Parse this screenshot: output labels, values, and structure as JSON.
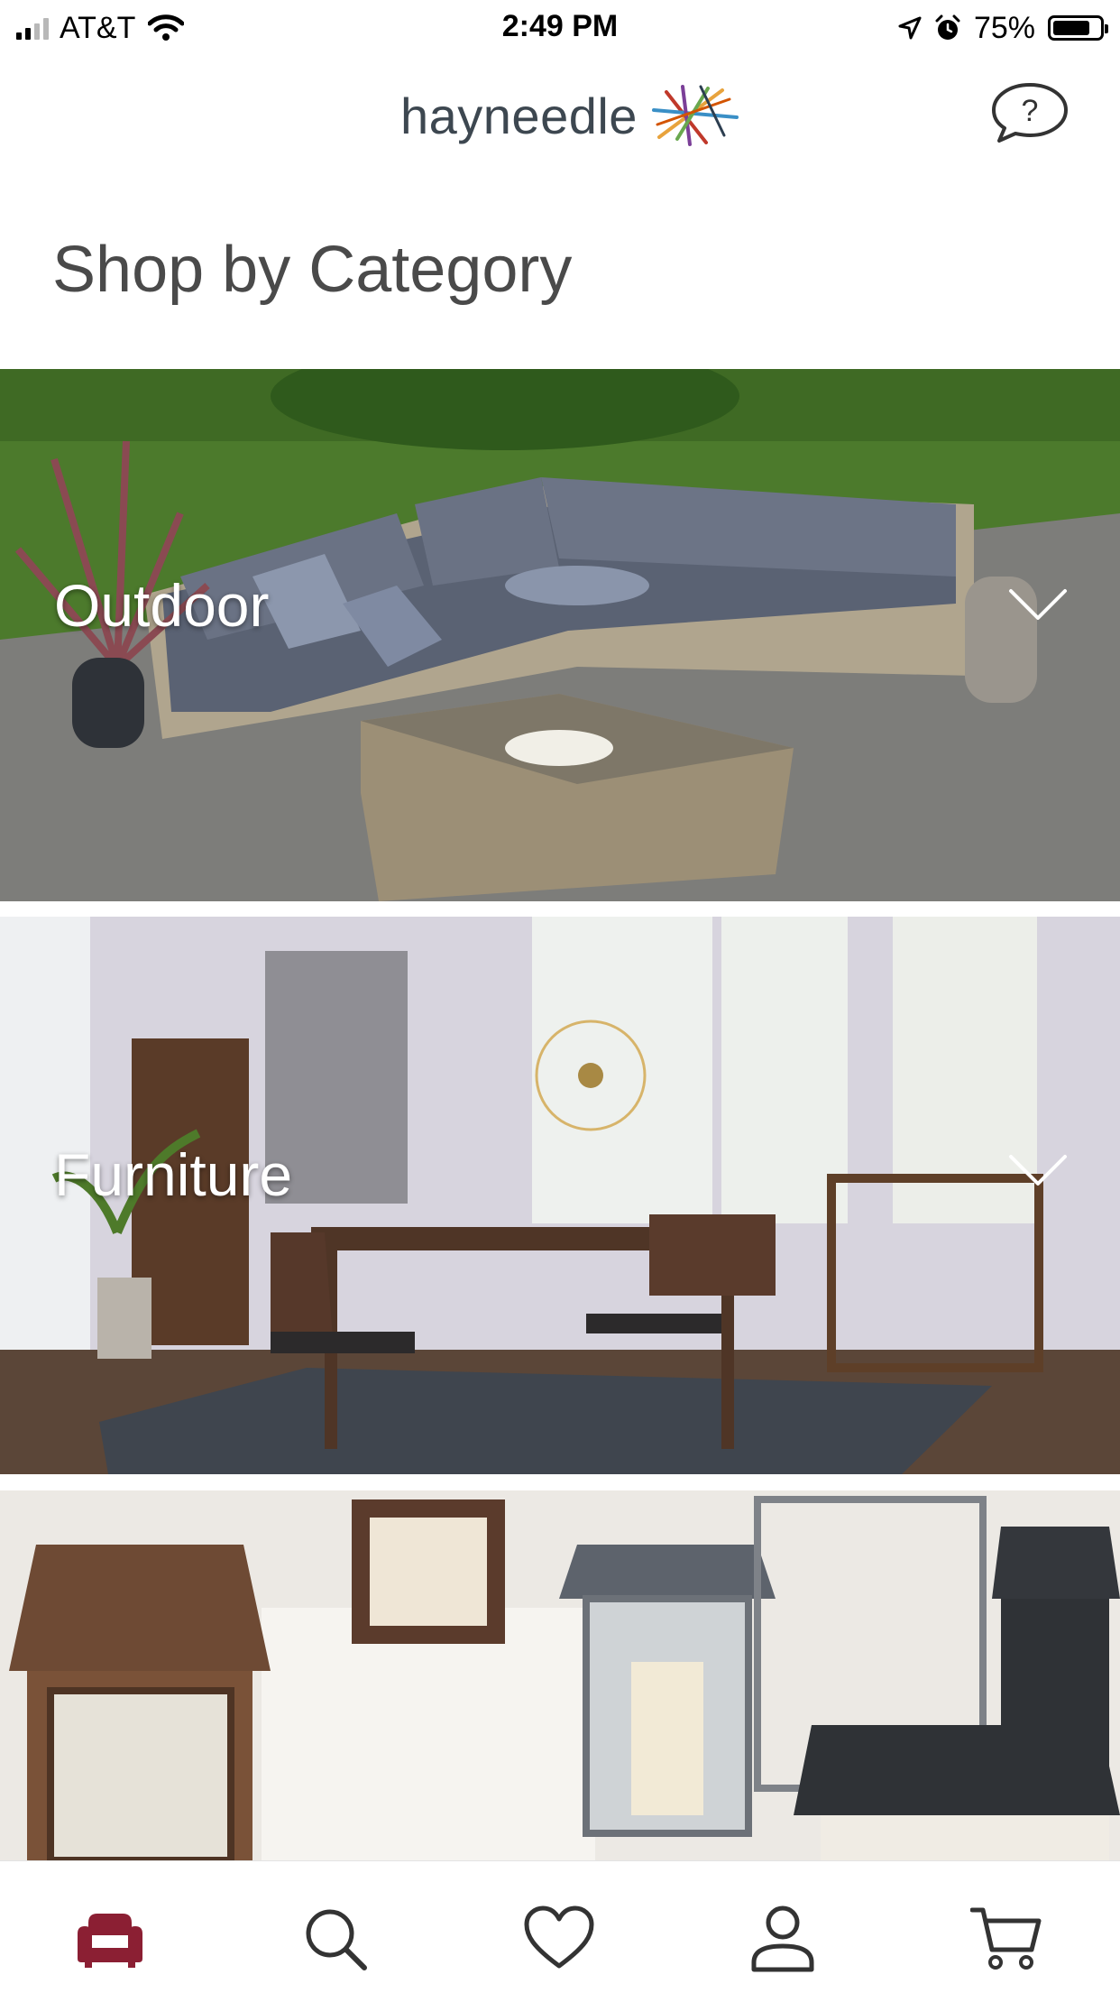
{
  "status_bar": {
    "carrier": "AT&T",
    "time": "2:49 PM",
    "battery_percent": "75%"
  },
  "header": {
    "logo_text": "hayneedle",
    "help_icon": "chat-question-icon"
  },
  "page": {
    "title": "Shop by Category"
  },
  "categories": [
    {
      "label": "Outdoor",
      "icon": "chevron-down-icon"
    },
    {
      "label": "Furniture",
      "icon": "chevron-down-icon"
    },
    {
      "label": "",
      "icon": ""
    }
  ],
  "tab_bar": {
    "items": [
      {
        "icon": "sofa-icon",
        "active": true
      },
      {
        "icon": "search-icon",
        "active": false
      },
      {
        "icon": "heart-icon",
        "active": false
      },
      {
        "icon": "account-icon",
        "active": false
      },
      {
        "icon": "cart-icon",
        "active": false
      }
    ]
  },
  "colors": {
    "accent": "#8b1f33",
    "icon": "#333333",
    "title": "#4a4a4a"
  }
}
